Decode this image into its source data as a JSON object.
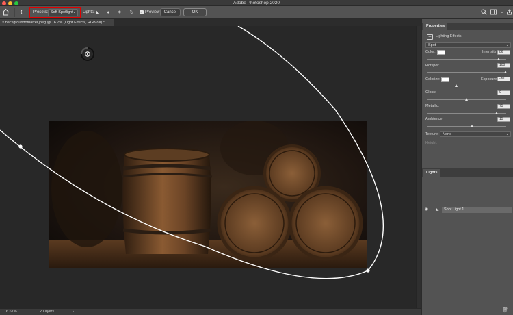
{
  "window": {
    "title": "Adobe Photoshop 2020"
  },
  "options_bar": {
    "presets_label": "Presets:",
    "preset_value": "Soft Spotlight",
    "lights_label": "Lights:",
    "preview_label": "Preview",
    "preview_checked": true,
    "cancel_label": "Cancel",
    "ok_label": "OK",
    "highlight_color": "#e00000"
  },
  "document": {
    "tab_title": "backgroundofbarrel.jpeg @ 16.7% (Light Effects, RGB/8#) *"
  },
  "status_bar": {
    "zoom": "16.67%",
    "layers": "2 Layers",
    "arrow": "›"
  },
  "properties": {
    "tab": "Properties",
    "header": "Lighting Effects",
    "light_type": "Spot",
    "color_label": "Color:",
    "intensity_label": "Intensity:",
    "intensity": "86",
    "hotspot_label": "Hotspot:",
    "hotspot": "100",
    "colorize_label": "Colorize:",
    "exposure_label": "Exposure:",
    "exposure": "-30",
    "gloss_label": "Gloss:",
    "gloss": "0",
    "metallic_label": "Metallic:",
    "metallic": "75",
    "ambience_label": "Ambience:",
    "ambience": "15",
    "texture_label": "Texture:",
    "texture_value": "None",
    "height_label": "Height:"
  },
  "lights_panel": {
    "tab": "Lights",
    "items": [
      {
        "name": "Spot Light 1"
      }
    ]
  }
}
